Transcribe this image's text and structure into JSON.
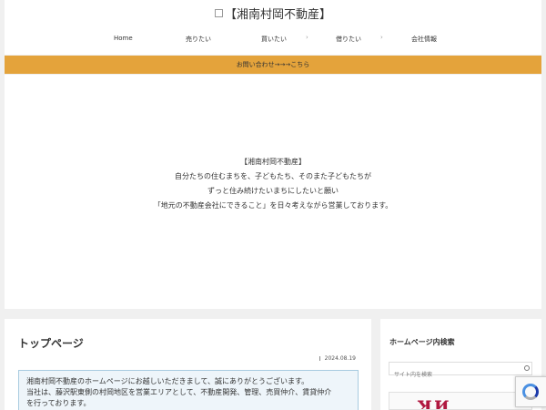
{
  "header": {
    "site_title": "【湘南村岡不動産】",
    "nav": [
      {
        "label": "Home"
      },
      {
        "label": "売りたい"
      },
      {
        "label": "買いたい"
      },
      {
        "label": "借りたい"
      },
      {
        "label": "会社情報"
      }
    ]
  },
  "notice": {
    "label": "お問い合わせ→→→こちら",
    "bg_color": "#e4a33b"
  },
  "hero": {
    "title": "【湘南村岡不動産】",
    "line1": "自分たちの住むまちを、子どもたち、そのまた子どもたちが",
    "line2": "ずっと住み続けたいまちにしたいと願い",
    "line3": "「地元の不動産会社にできること」を日々考えながら営業しております。"
  },
  "main": {
    "page_title": "トップページ",
    "date": "2024.08.19",
    "intro_line1": "湘南村岡不動産のホームページにお越しいただきまして、誠にありがとうございます。",
    "intro_line2": "当社は、藤沢駅東側の村岡地区を営業エリアとして、不動産開発、管理、売買仲介、賃貸仲介",
    "intro_line3": "を行っております。"
  },
  "sidebar": {
    "search_heading": "ホームページ内検索",
    "search_placeholder": "サイト内を検索"
  },
  "icons": {
    "search": "search-icon",
    "clock": "clock-icon",
    "recaptcha": "recaptcha-icon"
  }
}
